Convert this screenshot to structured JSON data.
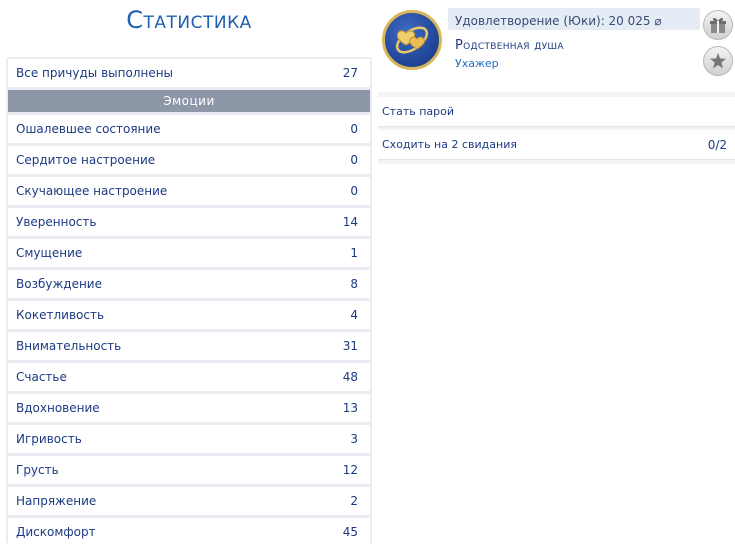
{
  "stats": {
    "title": "Статистика",
    "summary": {
      "label": "Все причуды выполнены",
      "value": "27"
    },
    "section": "Эмоции",
    "emotions": [
      {
        "label": "Ошалевшее состояние",
        "value": "0"
      },
      {
        "label": "Сердитое настроение",
        "value": "0"
      },
      {
        "label": "Скучающее настроение",
        "value": "0"
      },
      {
        "label": "Уверенность",
        "value": "14"
      },
      {
        "label": "Смущение",
        "value": "1"
      },
      {
        "label": "Возбуждение",
        "value": "8"
      },
      {
        "label": "Кокетливость",
        "value": "4"
      },
      {
        "label": "Внимательность",
        "value": "31"
      },
      {
        "label": "Счастье",
        "value": "48"
      },
      {
        "label": "Вдохновение",
        "value": "13"
      },
      {
        "label": "Игривость",
        "value": "3"
      },
      {
        "label": "Грусть",
        "value": "12"
      },
      {
        "label": "Напряжение",
        "value": "2"
      },
      {
        "label": "Дискомфорт",
        "value": "45"
      }
    ]
  },
  "aspiration": {
    "satisfaction": "Удовлетворение (Юки): 20  025 ⌀",
    "name": "Родственная душа",
    "level": "Ухажер",
    "goals": [
      {
        "label": "Стать парой",
        "progress": ""
      },
      {
        "label": "Сходить на 2 свидания",
        "progress": "0/2"
      }
    ]
  },
  "icons": {
    "badge": "hearts-badge-icon",
    "gift": "gift-icon",
    "star": "star-icon"
  },
  "colors": {
    "accent": "#1d5fb0",
    "section_header": "#8e97a8",
    "badge_gold": "#d9b65a",
    "badge_blue": "#23489a"
  }
}
